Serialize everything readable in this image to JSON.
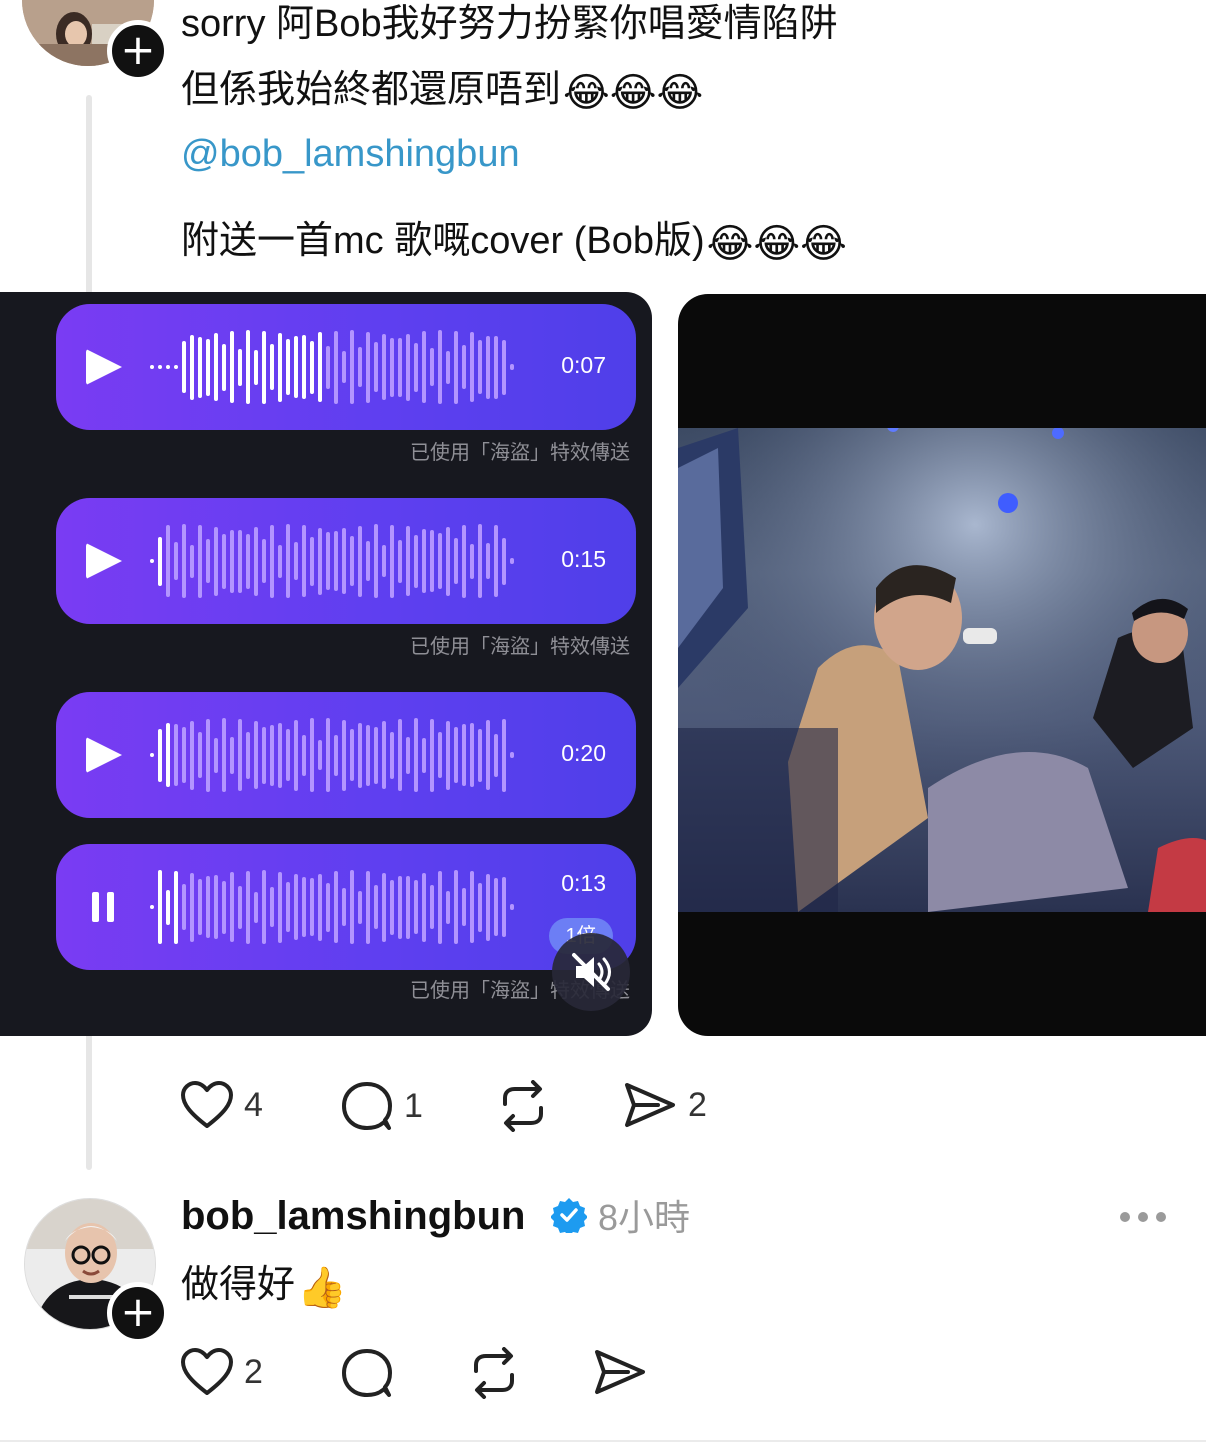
{
  "post": {
    "lines": [
      "sorry 阿Bob我好努力扮緊你唱愛情陷阱",
      "但係我始終都還原唔到",
      "@bob_lamshingbun",
      "附送一首mc 歌嘅cover (Bob版)"
    ],
    "emoji": "😂😂😂"
  },
  "voice_messages": [
    {
      "duration": "0:07",
      "control": "play-icon",
      "caption": "已使用「海盜」特效傳送"
    },
    {
      "duration": "0:15",
      "control": "play-icon",
      "caption": "已使用「海盜」特效傳送"
    },
    {
      "duration": "0:20",
      "control": "play-icon"
    },
    {
      "duration": "0:13",
      "control": "pause-icon",
      "speed": "1倍",
      "caption": "已使用「海盜」特效傳送"
    }
  ],
  "post_actions": {
    "likes": "4",
    "comments": "1",
    "reposts": "",
    "shares": "2"
  },
  "reply": {
    "username": "bob_lamshingbun",
    "verified": true,
    "time": "8小時",
    "text": "做得好",
    "emoji": "👍",
    "actions": {
      "likes": "2",
      "comments": "",
      "reposts": "",
      "shares": ""
    }
  },
  "colors": {
    "link": "#3897c9",
    "verified": "#1d9bf0",
    "voice_bubble": "#6a3ef2"
  }
}
